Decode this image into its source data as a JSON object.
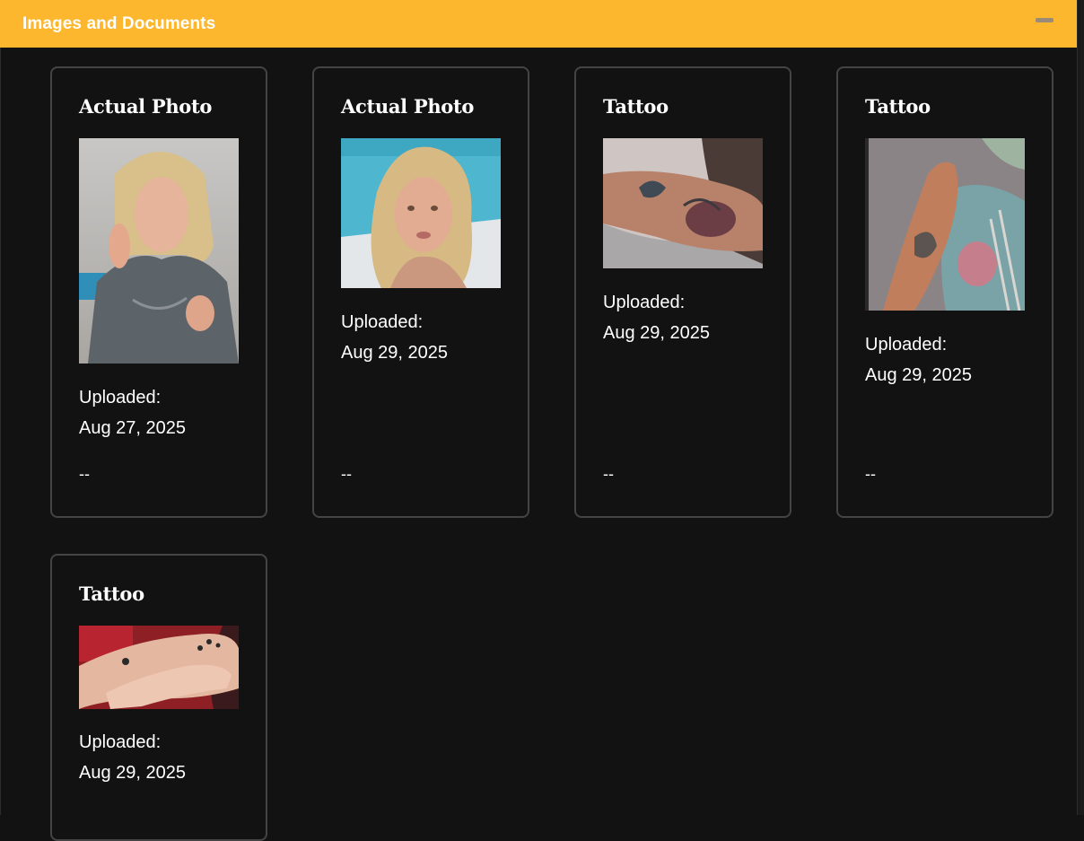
{
  "header": {
    "title": "Images and Documents"
  },
  "cards": [
    {
      "title": "Actual Photo",
      "uploaded_label": "Uploaded:",
      "date": "Aug 27, 2025",
      "note": "--",
      "image": "photo-blonde-woman-gray-shirt"
    },
    {
      "title": "Actual Photo",
      "uploaded_label": "Uploaded:",
      "date": "Aug 29, 2025",
      "note": "--",
      "image": "photo-blonde-woman-selfie"
    },
    {
      "title": "Tattoo",
      "uploaded_label": "Uploaded:",
      "date": "Aug 29, 2025",
      "note": "--",
      "image": "photo-forearm-tattoo"
    },
    {
      "title": "Tattoo",
      "uploaded_label": "Uploaded:",
      "date": "Aug 29, 2025",
      "note": "--",
      "image": "photo-leg-tattoo"
    },
    {
      "title": "Tattoo",
      "uploaded_label": "Uploaded:",
      "date": "Aug 29, 2025",
      "note": "--",
      "image": "photo-hand-tattoos"
    }
  ],
  "colors": {
    "header_bg": "#fcb72e",
    "page_bg": "#121212",
    "card_border": "#444444"
  },
  "icons": {
    "collapse": "minus-icon"
  }
}
